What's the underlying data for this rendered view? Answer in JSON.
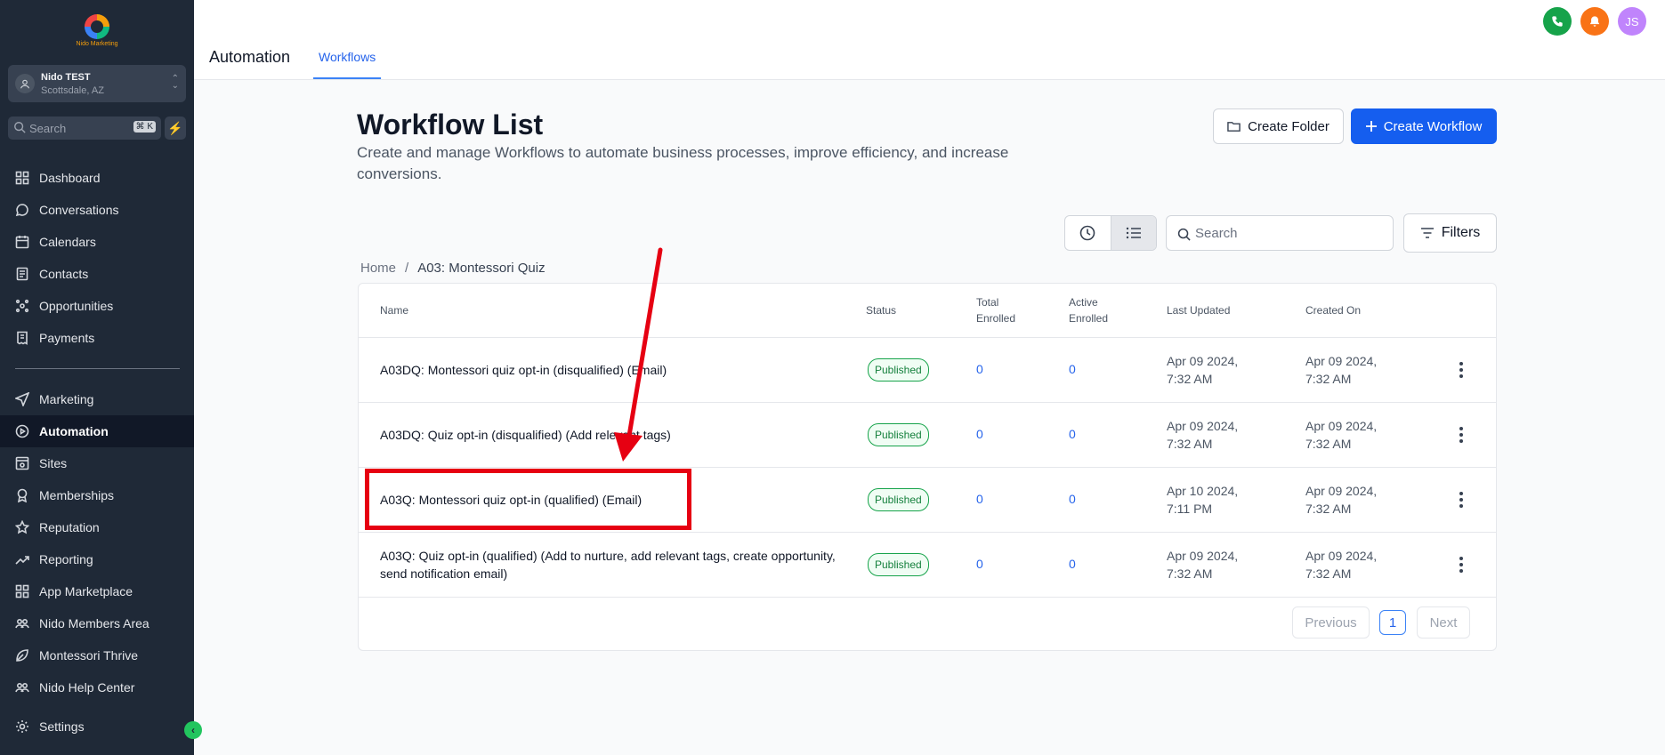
{
  "brand": {
    "logo_text": "Nido Marketing"
  },
  "account": {
    "name": "Nido TEST",
    "location": "Scottsdale, AZ"
  },
  "sidebar_search": {
    "placeholder": "Search",
    "shortcut": "⌘ K"
  },
  "nav": [
    {
      "label": "Dashboard",
      "icon": "dashboard-icon"
    },
    {
      "label": "Conversations",
      "icon": "chat-bubble-icon"
    },
    {
      "label": "Calendars",
      "icon": "calendar-icon"
    },
    {
      "label": "Contacts",
      "icon": "contacts-icon"
    },
    {
      "label": "Opportunities",
      "icon": "opportunities-icon"
    },
    {
      "label": "Payments",
      "icon": "receipt-icon"
    },
    {
      "label": "Marketing",
      "icon": "send-icon"
    },
    {
      "label": "Automation",
      "icon": "automation-icon",
      "active": true
    },
    {
      "label": "Sites",
      "icon": "sites-icon"
    },
    {
      "label": "Memberships",
      "icon": "award-icon"
    },
    {
      "label": "Reputation",
      "icon": "star-icon"
    },
    {
      "label": "Reporting",
      "icon": "trend-icon"
    },
    {
      "label": "App Marketplace",
      "icon": "grid-icon"
    },
    {
      "label": "Nido Members Area",
      "icon": "users-icon"
    },
    {
      "label": "Montessori Thrive",
      "icon": "leaf-icon"
    },
    {
      "label": "Nido Help Center",
      "icon": "users-icon"
    },
    {
      "label": "Settings",
      "icon": "gear-icon"
    }
  ],
  "header": {
    "title": "Automation",
    "tab": "Workflows",
    "avatar_initials": "JS"
  },
  "page": {
    "title": "Workflow List",
    "description": "Create and manage Workflows to automate business processes, improve efficiency, and increase conversions.",
    "create_folder": "Create Folder",
    "create_workflow": "Create Workflow",
    "search_placeholder": "Search",
    "filters": "Filters"
  },
  "breadcrumb": {
    "home": "Home",
    "separator": "/",
    "current": "A03: Montessori Quiz"
  },
  "table": {
    "columns": {
      "name": "Name",
      "status": "Status",
      "total_enrolled_1": "Total",
      "total_enrolled_2": "Enrolled",
      "active_enrolled_1": "Active",
      "active_enrolled_2": "Enrolled",
      "last_updated": "Last Updated",
      "created_on": "Created On"
    },
    "rows": [
      {
        "name": "A03DQ: Montessori quiz opt-in (disqualified) (Email)",
        "status": "Published",
        "total": "0",
        "active": "0",
        "updated_1": "Apr 09 2024,",
        "updated_2": "7:32 AM",
        "created_1": "Apr 09 2024,",
        "created_2": "7:32 AM"
      },
      {
        "name": "A03DQ: Quiz opt-in (disqualified) (Add relevant tags)",
        "status": "Published",
        "total": "0",
        "active": "0",
        "updated_1": "Apr 09 2024,",
        "updated_2": "7:32 AM",
        "created_1": "Apr 09 2024,",
        "created_2": "7:32 AM"
      },
      {
        "name": "A03Q: Montessori quiz opt-in (qualified) (Email)",
        "status": "Published",
        "total": "0",
        "active": "0",
        "updated_1": "Apr 10 2024,",
        "updated_2": "7:11 PM",
        "created_1": "Apr 09 2024,",
        "created_2": "7:32 AM"
      },
      {
        "name": "A03Q: Quiz opt-in (qualified) (Add to nurture, add relevant tags, create opportunity, send notification email)",
        "status": "Published",
        "total": "0",
        "active": "0",
        "updated_1": "Apr 09 2024,",
        "updated_2": "7:32 AM",
        "created_1": "Apr 09 2024,",
        "created_2": "7:32 AM"
      }
    ]
  },
  "pagination": {
    "previous": "Previous",
    "current": "1",
    "next": "Next"
  },
  "colors": {
    "sidebar": "#1f2937",
    "primary": "#155eef",
    "annotation": "#e60012",
    "phone": "#16a34a",
    "bell": "#f97316",
    "avatar": "#c084fc"
  }
}
